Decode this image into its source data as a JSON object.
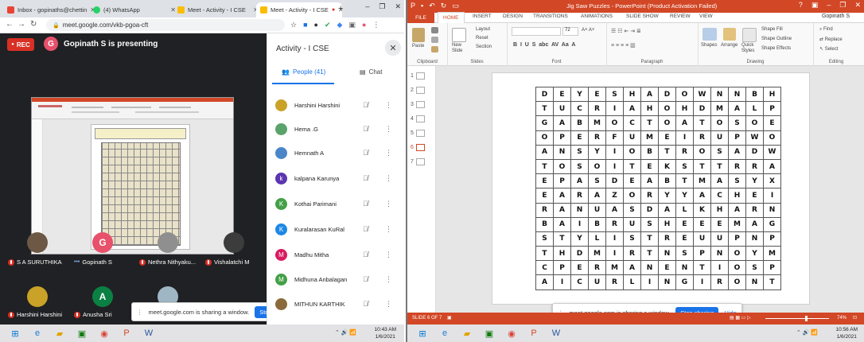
{
  "browser": {
    "tabs": [
      {
        "label": "Inbox - gopinaths@chettin",
        "favicon": "gmail-icon",
        "color": "#ea4335"
      },
      {
        "label": "(4) WhatsApp",
        "favicon": "whatsapp-icon",
        "color": "#25d366"
      },
      {
        "label": "Meet - Activity - I CSE",
        "favicon": "meet-icon",
        "color": "#fbbc04"
      },
      {
        "label": "Meet - Activity - I CSE",
        "favicon": "meet-icon",
        "color": "#fbbc04",
        "active": true
      }
    ],
    "url": "meet.google.com/vkb-pgoa-cft"
  },
  "meet": {
    "rec_label": "REC",
    "presenter_initial": "G",
    "presenting_text": "Gopinath S is presenting",
    "panel_title": "Activity - I CSE",
    "people_tab": "People (41)",
    "chat_tab": "Chat",
    "participants": [
      {
        "name": "Harshini Harshini",
        "color": "#c9a227"
      },
      {
        "name": "Hema .G",
        "color": "#5aa36b"
      },
      {
        "name": "Hemnath A",
        "color": "#4a86c8"
      },
      {
        "name": "kalpana Karunya",
        "initial": "k",
        "color": "#5c35b0"
      },
      {
        "name": "Kothai Parimani",
        "initial": "K",
        "color": "#43a047"
      },
      {
        "name": "Kuralarasan KuRal",
        "initial": "K",
        "color": "#1e88e5"
      },
      {
        "name": "Madhu Mitha",
        "initial": "M",
        "color": "#d81b60"
      },
      {
        "name": "Midhuna Anbalagan",
        "initial": "M",
        "color": "#43a047"
      },
      {
        "name": "MITHUN KARTHIK",
        "color": "#8a6a3a"
      }
    ],
    "tiles": [
      {
        "name": "S A SURUTHIKA",
        "color": "#6d5846",
        "muted": true
      },
      {
        "name": "Gopinath S",
        "initial": "G",
        "color": "#e7516b",
        "muted": false
      },
      {
        "name": "Nethra Nithyaku...",
        "color": "#8f8f8f",
        "muted": true
      },
      {
        "name": "Vishalatchi M",
        "color": "#3c3c3c",
        "muted": true
      },
      {
        "name": "Harshini Harshini",
        "color": "#c9a227",
        "muted": true
      },
      {
        "name": "Anusha Sri",
        "initial": "A",
        "color": "#0b8043",
        "muted": true
      }
    ],
    "sharing_text": "meet.google.com is sharing a window.",
    "stop_label": "Stop sharing",
    "hide_label": "Hide"
  },
  "taskbar_left": {
    "time": "10:43 AM",
    "date": "1/6/2021"
  },
  "powerpoint": {
    "title": "Jig Saw Puzzles - PowerPoint (Product Activation Failed)",
    "user": "Gopinath S",
    "ribbon_tabs": [
      "FILE",
      "HOME",
      "INSERT",
      "DESIGN",
      "TRANSITIONS",
      "ANIMATIONS",
      "SLIDE SHOW",
      "REVIEW",
      "VIEW"
    ],
    "groups": {
      "clipboard": "Clipboard",
      "slides": "Slides",
      "font": "Font",
      "paragraph": "Paragraph",
      "drawing": "Drawing",
      "editing": "Editing"
    },
    "ribbon_items": {
      "paste": "Paste",
      "new_slide": "New Slide",
      "layout": "Layout",
      "reset": "Reset",
      "section": "Section",
      "shapes": "Shapes",
      "arrange": "Arrange",
      "quick_styles": "Quick Styles",
      "shape_fill": "Shape Fill",
      "shape_outline": "Shape Outline",
      "shape_effects": "Shape Effects",
      "find": "Find",
      "replace": "Replace",
      "select": "Select",
      "font_size": "72"
    },
    "slide_numbers": [
      "1",
      "2",
      "3",
      "4",
      "5",
      "6",
      "7"
    ],
    "active_slide": 5,
    "puzzle_rows": [
      "DEYESHADOWNNBH",
      "TUCRIAHOHDMALP",
      "GABMOCTOATOSOE",
      "OPERFUMEIRUPWO",
      "ANSYIOBTROSADW",
      "TOSOITEKSTTRRA",
      "EPASDEABTMASYX",
      "EARAZORYYACHEI",
      "RANUASDALKHARN",
      "BAIBRUSHEEEMAG",
      "STYLISTREUUPNP",
      "THDMIRTNSPNOYM",
      "CPERMANENTIOSP",
      "AICURLINGIRONT"
    ],
    "status_slide": "SLIDE 6 OF 7",
    "zoom": "74%"
  },
  "taskbar_right": {
    "time": "10:56 AM",
    "date": "1/6/2021"
  }
}
